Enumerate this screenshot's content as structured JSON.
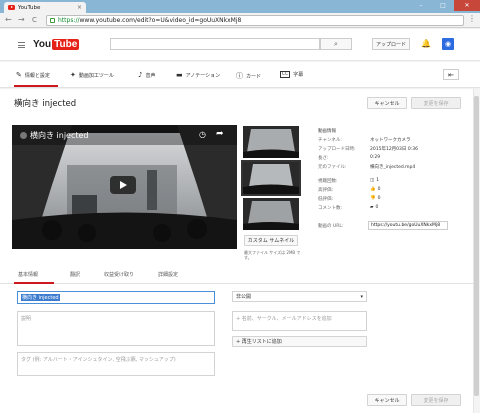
{
  "browser": {
    "tab_title": "YouTube",
    "tab_close": "×",
    "win_min": "–",
    "win_max": "□",
    "win_close": "✕",
    "back": "←",
    "forward": "→",
    "reload": "C",
    "url_scheme": "https://",
    "url_rest": "www.youtube.com/edit?o=U&video_id=goUuXNkxMj8",
    "menu": "⋮"
  },
  "masthead": {
    "logo_you": "You",
    "logo_tube": "Tube",
    "search_icon": "⌕",
    "upload_label": "アップロード",
    "bell_icon": "🔔",
    "avatar_icon": "◉"
  },
  "edit_tabs": [
    {
      "icon": "✎",
      "label": "情報と設定"
    },
    {
      "icon": "✦",
      "label": "動画加工ツール"
    },
    {
      "icon": "♪",
      "label": "音声"
    },
    {
      "icon": "▬",
      "label": "アノテーション"
    },
    {
      "icon": "ⓘ",
      "label": "カード"
    },
    {
      "icon": "CC",
      "label": "字幕"
    }
  ],
  "back_button": "⇤",
  "video": {
    "title": "横向き injected",
    "cancel_label": "キャンセル",
    "save_label": "変更を保存",
    "player_title": "横向き injected",
    "clock_icon": "◷",
    "share_icon": "➦"
  },
  "thumbs": {
    "custom_label": "カスタム サムネイル",
    "note": "最大ファイル サイズは 2MB です。"
  },
  "info": {
    "heading": "動画情報",
    "rows": [
      {
        "label": "チャンネル:",
        "value": "ネットワークカメラ"
      },
      {
        "label": "アップロード日時:",
        "value": "2015年12月03日 0:36"
      },
      {
        "label": "長さ:",
        "value": "0:29"
      },
      {
        "label": "元のファイル:",
        "value": "横向き_injected.mp4"
      }
    ],
    "stats": [
      {
        "label": "視聴回数:",
        "icon": "◫",
        "value": "1"
      },
      {
        "label": "高評価:",
        "icon": "👍",
        "value": "0"
      },
      {
        "label": "低評価:",
        "icon": "👎",
        "value": "0"
      },
      {
        "label": "コメント数:",
        "icon": "▰",
        "value": "0"
      }
    ],
    "url_label": "動画の URL:",
    "url_value": "https://youtu.be/goUuXNkxMj8"
  },
  "sub_tabs": [
    "基本情報",
    "翻訳",
    "収益受け取り",
    "詳細設定"
  ],
  "form": {
    "title_value": "横向き injected",
    "desc_placeholder": "説明",
    "tags_placeholder": "タグ (例: アルバート・アインシュタイン, 空飛ぶ豚, マッシュアップ)",
    "visibility": "非公開",
    "caret": "▾",
    "share_placeholder": "+ 名前、サークル、メールアドレスを追加",
    "playlist_label": "+ 再生リストに追加",
    "cancel_label": "キャンセル",
    "save_label": "変更を保存"
  }
}
